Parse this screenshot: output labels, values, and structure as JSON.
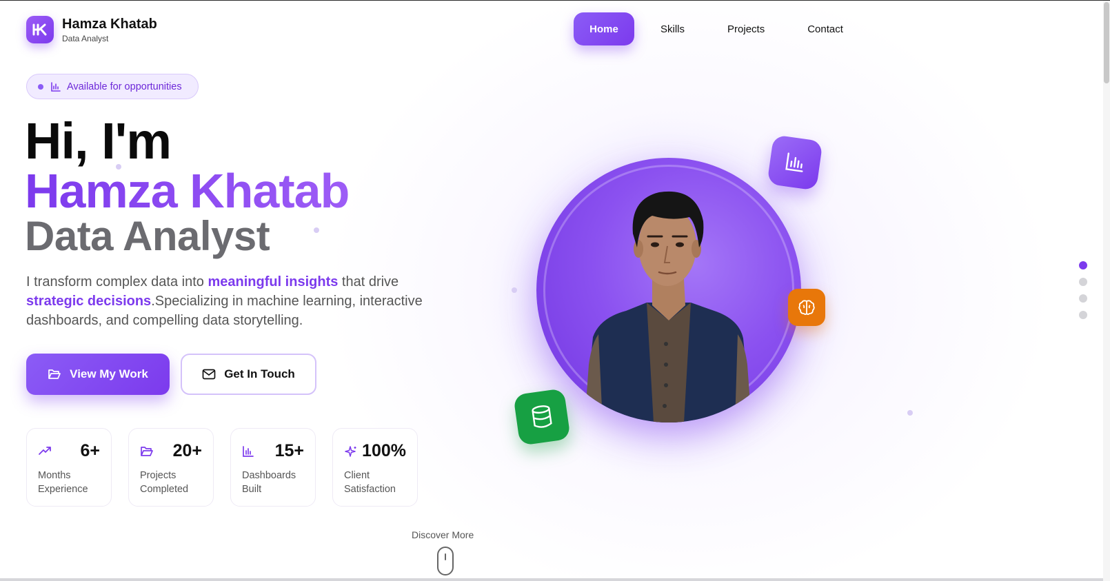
{
  "brand": {
    "logo_text": "K",
    "name": "Hamza Khatab",
    "role": "Data Analyst"
  },
  "nav": {
    "items": [
      {
        "label": "Home",
        "active": true
      },
      {
        "label": "Skills"
      },
      {
        "label": "Projects"
      },
      {
        "label": "Contact"
      }
    ]
  },
  "badge": {
    "label": "Available for opportunities"
  },
  "hero": {
    "greeting": "Hi, I'm",
    "name": "Hamza Khatab",
    "role": "Data Analyst",
    "desc_1": "I transform complex data into ",
    "desc_hl_1": "meaningful insights",
    "desc_2": " that drive ",
    "desc_hl_2": "strategic decisions",
    "desc_3": ".Specializing in machine learning, interactive dashboards, and compelling data storytelling."
  },
  "buttons": {
    "primary": "View My Work",
    "secondary": "Get In Touch"
  },
  "stats": [
    {
      "value": "6+",
      "label": "Months Experience",
      "icon": "trending-up-icon"
    },
    {
      "value": "20+",
      "label": "Projects Completed",
      "icon": "folder-icon"
    },
    {
      "value": "15+",
      "label": "Dashboards Built",
      "icon": "bar-chart-icon"
    },
    {
      "value": "100%",
      "label": "Client Satisfaction",
      "icon": "sparkles-icon"
    }
  ],
  "discover": {
    "label": "Discover More"
  },
  "colors": {
    "accent": "#7c3aed",
    "orange": "#e8770a",
    "green": "#17a043"
  }
}
